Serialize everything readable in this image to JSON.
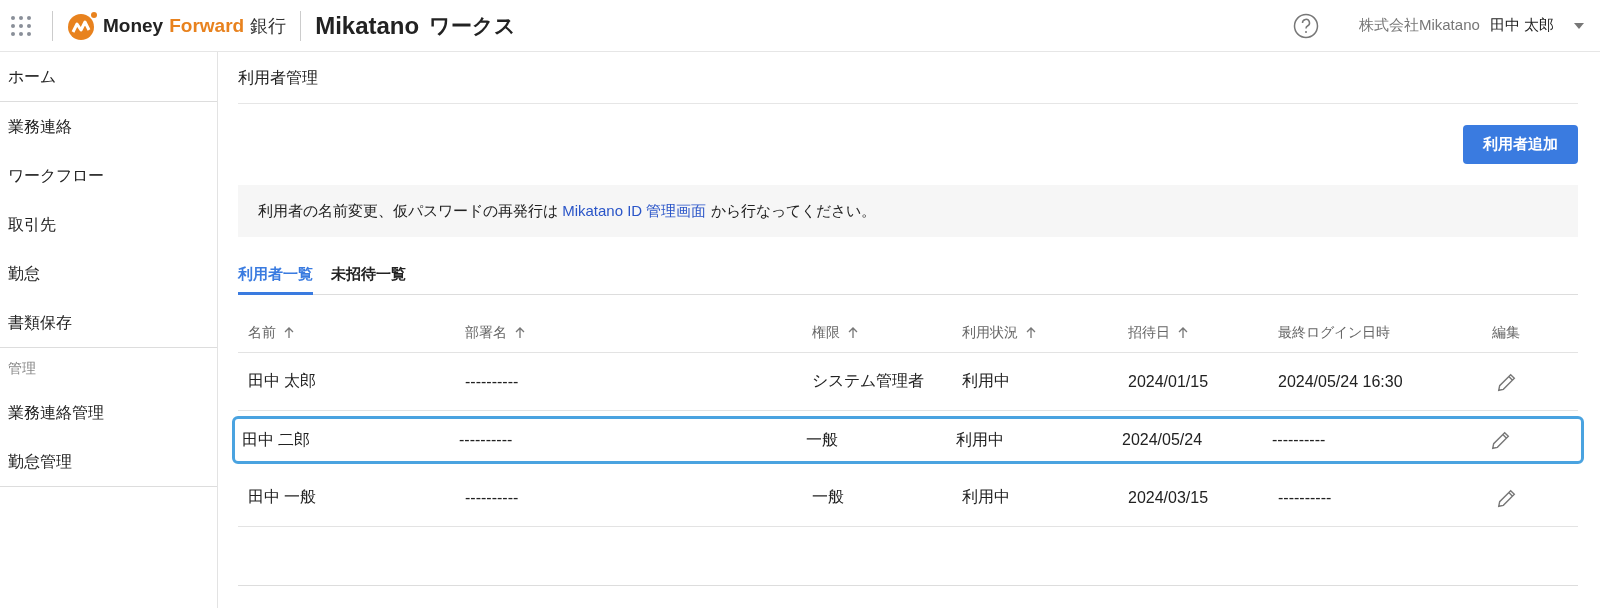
{
  "header": {
    "brand": {
      "name_a": "Money ",
      "name_b": "Forward",
      "suffix": "銀行"
    },
    "product": {
      "name": "Mikatano",
      "suffix": "ワークス"
    },
    "company": "株式会社Mikatano",
    "user": "田中 太郎"
  },
  "sidebar": {
    "groups": [
      {
        "items": [
          {
            "label": "ホーム"
          }
        ]
      },
      {
        "items": [
          {
            "label": "業務連絡"
          },
          {
            "label": "ワークフロー"
          },
          {
            "label": "取引先"
          },
          {
            "label": "勤怠"
          },
          {
            "label": "書類保存"
          }
        ]
      },
      {
        "heading": "管理",
        "items": [
          {
            "label": "業務連絡管理"
          },
          {
            "label": "勤怠管理"
          }
        ]
      }
    ]
  },
  "page": {
    "title": "利用者管理",
    "add_button": "利用者追加",
    "notice": {
      "before": "利用者の名前変更、仮パスワードの再発行は ",
      "link": "Mikatano ID 管理画面",
      "after": " から行なってください。"
    },
    "tabs": [
      {
        "label": "利用者一覧",
        "selected": true
      },
      {
        "label": "未招待一覧",
        "selected": false
      }
    ],
    "table": {
      "columns": [
        {
          "label": "名前",
          "sortable": true
        },
        {
          "label": "部署名",
          "sortable": true
        },
        {
          "label": "権限",
          "sortable": true
        },
        {
          "label": "利用状況",
          "sortable": true
        },
        {
          "label": "招待日",
          "sortable": true
        },
        {
          "label": "最終ログイン日時",
          "sortable": false
        },
        {
          "label": "編集",
          "sortable": false
        }
      ],
      "rows": [
        {
          "cells": [
            "田中 太郎",
            "----------",
            "システム管理者",
            "利用中",
            "2024/01/15",
            "2024/05/24 16:30"
          ],
          "highlighted": false
        },
        {
          "cells": [
            "田中 二郎",
            "----------",
            "一般",
            "利用中",
            "2024/05/24",
            "----------"
          ],
          "highlighted": true
        },
        {
          "cells": [
            "田中 一般",
            "----------",
            "一般",
            "利用中",
            "2024/03/15",
            "----------"
          ],
          "highlighted": false
        }
      ]
    }
  }
}
